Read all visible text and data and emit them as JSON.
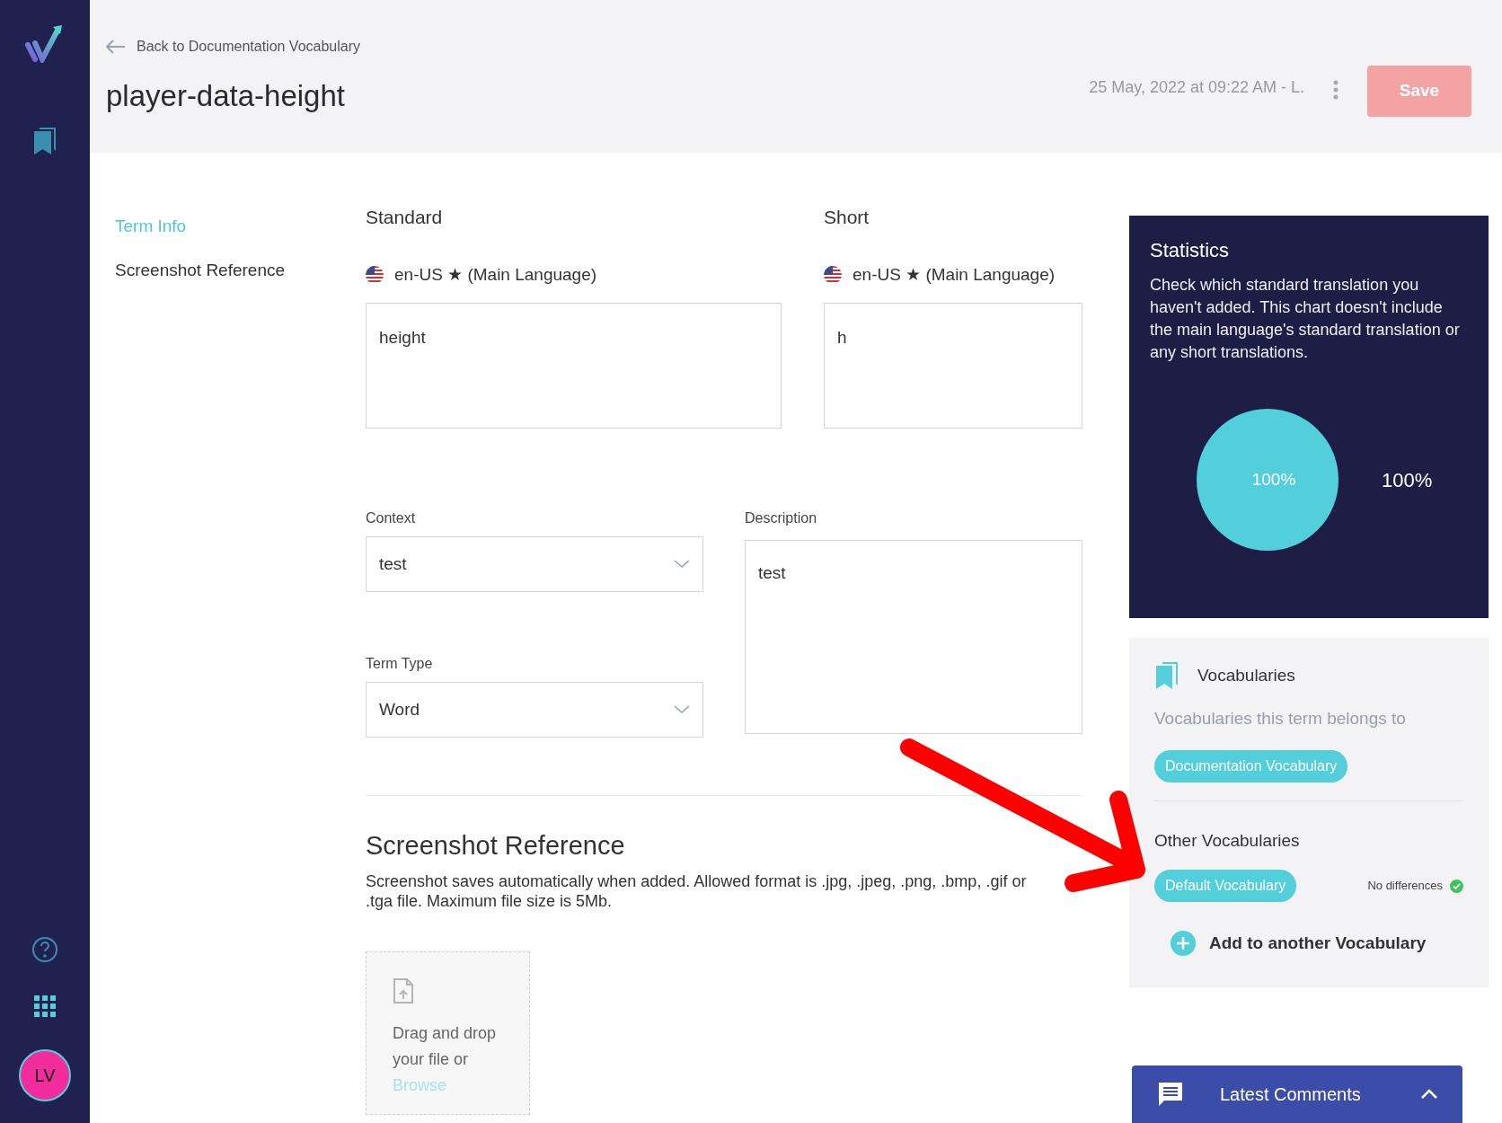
{
  "sidebar": {
    "avatar": "LV"
  },
  "header": {
    "back_link": "Back to Documentation Vocabulary",
    "title": "player-data-height",
    "timestamp": "25 May, 2022 at 09:22 AM - L.",
    "save_button": {
      "label": "Save",
      "disabled": true
    }
  },
  "nav": [
    {
      "label": "Term Info",
      "selected": true
    },
    {
      "label": "Screenshot Reference",
      "selected": false
    }
  ],
  "translations": [
    {
      "heading": "Standard",
      "language": "en-US ★ (Main Language)",
      "value": "height"
    },
    {
      "heading": "Short",
      "language": "en-US ★ (Main Language)",
      "value": "h"
    }
  ],
  "context": {
    "label": "Context",
    "value": "test"
  },
  "term_type": {
    "label": "Term Type",
    "value": "Word"
  },
  "description": {
    "label": "Description",
    "value": "test"
  },
  "screenshot_reference": {
    "heading": "Screenshot Reference",
    "text": "Screenshot saves automatically when added. Allowed format is .jpg, .jpeg, .png, .bmp, .gif or .tga file. Maximum file size is 5Mb.",
    "drop_text": "Drag and drop your file or",
    "browse_link": "Browse"
  },
  "statistics": {
    "title": "Statistics",
    "text": "Check which standard translation you haven't added. This chart doesn't include the main language's standard translation or any short translations.",
    "chart_data": {
      "type": "pie",
      "categories": [
        "100%"
      ],
      "values": [
        100
      ],
      "value_labels": [
        "100%"
      ]
    }
  },
  "vocabularies": {
    "title": "Vocabularies",
    "subtitle": "Vocabularies this term belongs to",
    "tags": [
      "Documentation Vocabulary"
    ],
    "other_title": "Other Vocabularies",
    "other": [
      {
        "tag": "Default Vocabulary",
        "status": "No differences"
      }
    ],
    "add_button": "Add to another Vocabulary"
  },
  "comments_bar": {
    "label": "Latest Comments",
    "expanded": false
  }
}
